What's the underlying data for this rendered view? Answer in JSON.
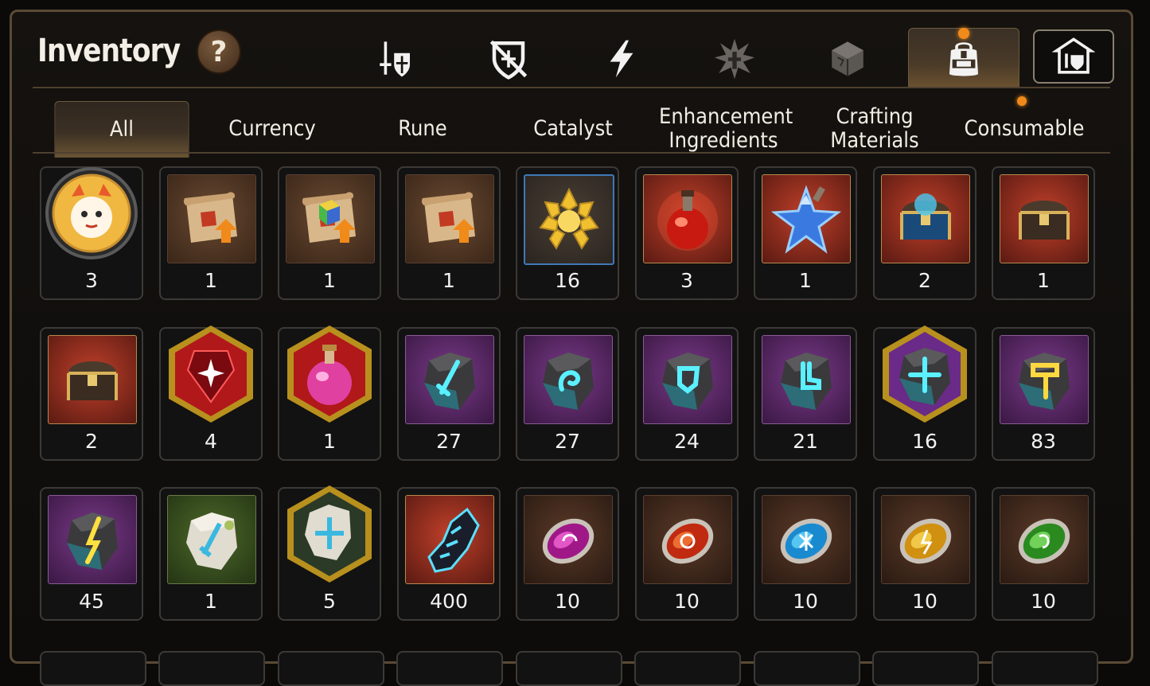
{
  "header": {
    "title": "Inventory",
    "help_label": "?"
  },
  "category_icons": [
    {
      "icon": "sword-shield-icon",
      "active": false
    },
    {
      "icon": "broken-shield-icon",
      "active": false
    },
    {
      "icon": "lightning-icon",
      "active": false
    },
    {
      "icon": "burst-icon",
      "active": false
    },
    {
      "icon": "cube-icon",
      "active": false
    },
    {
      "icon": "backpack-icon",
      "active": true,
      "notification": true
    },
    {
      "icon": "guild-house-icon",
      "active": false
    }
  ],
  "tabs": [
    {
      "label": "All",
      "active": true
    },
    {
      "label": "Currency"
    },
    {
      "label": "Rune"
    },
    {
      "label": "Catalyst"
    },
    {
      "label": "Enhancement Ingredients"
    },
    {
      "label": "Crafting Materials"
    },
    {
      "label": "Consumable",
      "notification": true
    }
  ],
  "items": [
    {
      "icon": "hero-portrait-icon",
      "qty": "3"
    },
    {
      "icon": "scroll-upgrade-icon",
      "qty": "1"
    },
    {
      "icon": "scroll-rainbow-cube-icon",
      "qty": "1"
    },
    {
      "icon": "scroll-upgrade-icon",
      "qty": "1"
    },
    {
      "icon": "gold-crystal-icon",
      "qty": "16"
    },
    {
      "icon": "red-potion-icon",
      "qty": "3"
    },
    {
      "icon": "blue-star-icon",
      "qty": "1"
    },
    {
      "icon": "blue-chest-icon",
      "qty": "2"
    },
    {
      "icon": "gold-chest-icon",
      "qty": "1"
    },
    {
      "icon": "gold-chest-icon",
      "qty": "2"
    },
    {
      "icon": "red-gem-icon",
      "qty": "4"
    },
    {
      "icon": "pink-potion-icon",
      "qty": "1"
    },
    {
      "icon": "sword-rune-stone-icon",
      "qty": "27"
    },
    {
      "icon": "swirl-rune-stone-icon",
      "qty": "27"
    },
    {
      "icon": "armor-rune-stone-icon",
      "qty": "24"
    },
    {
      "icon": "boot-rune-stone-icon",
      "qty": "21"
    },
    {
      "icon": "star-rune-stone-icon",
      "qty": "16"
    },
    {
      "icon": "hammer-rune-stone-icon",
      "qty": "83"
    },
    {
      "icon": "bolt-rune-stone-icon",
      "qty": "45"
    },
    {
      "icon": "white-sword-stone-icon",
      "qty": "1"
    },
    {
      "icon": "white-star-stone-icon",
      "qty": "5"
    },
    {
      "icon": "dark-crystal-shard-icon",
      "qty": "400"
    },
    {
      "icon": "purple-coin-icon",
      "qty": "10"
    },
    {
      "icon": "red-coin-icon",
      "qty": "10"
    },
    {
      "icon": "cyan-coin-icon",
      "qty": "10"
    },
    {
      "icon": "yellow-coin-icon",
      "qty": "10"
    },
    {
      "icon": "green-coin-icon",
      "qty": "10"
    }
  ],
  "colors": {
    "accent_orange": "#f08a1a",
    "frame_gold": "#8a7250",
    "text": "#f2ede4"
  }
}
